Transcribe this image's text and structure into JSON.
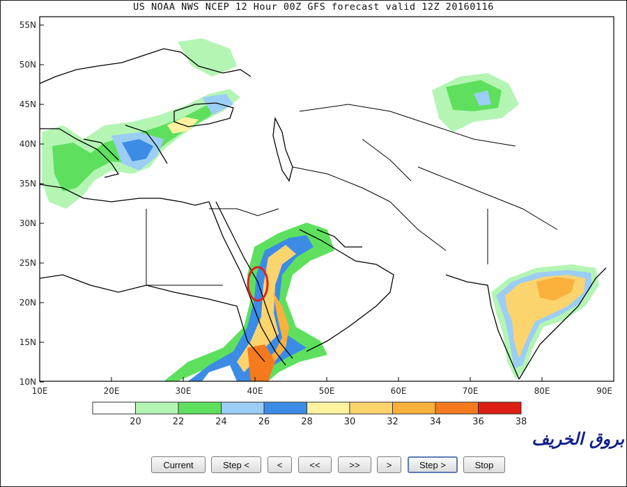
{
  "map": {
    "title": "US NOAA NWS NCEP 12 Hour 00Z GFS forecast valid 12Z 20160116",
    "lat_labels": [
      "55N",
      "50N",
      "45N",
      "40N",
      "35N",
      "30N",
      "25N",
      "20N",
      "15N",
      "10N"
    ],
    "lon_labels": [
      "10E",
      "20E",
      "30E",
      "40E",
      "50E",
      "60E",
      "70E",
      "80E",
      "90E"
    ],
    "extent": {
      "lon": [
        10,
        90
      ],
      "lat": [
        10,
        56
      ]
    }
  },
  "colorbar": {
    "labels": [
      "20",
      "22",
      "24",
      "26",
      "28",
      "30",
      "32",
      "34",
      "36",
      "38"
    ],
    "colors": [
      "#ffffff",
      "#b4f5b4",
      "#5ee05e",
      "#9ccdf5",
      "#3c8ce6",
      "#fff3a0",
      "#fcd46e",
      "#f9b13c",
      "#f57a1e",
      "#dc1e14"
    ]
  },
  "watermark": "بروق الخريف",
  "controls": {
    "current": "Current",
    "step_back": "Step <",
    "prev": "<",
    "rewind": "<<",
    "fast_forward": ">>",
    "next": ">",
    "step_forward": "Step >",
    "stop": "Stop"
  },
  "colors": {
    "highlight_circle": "#e02020",
    "coastline": "#000000"
  }
}
